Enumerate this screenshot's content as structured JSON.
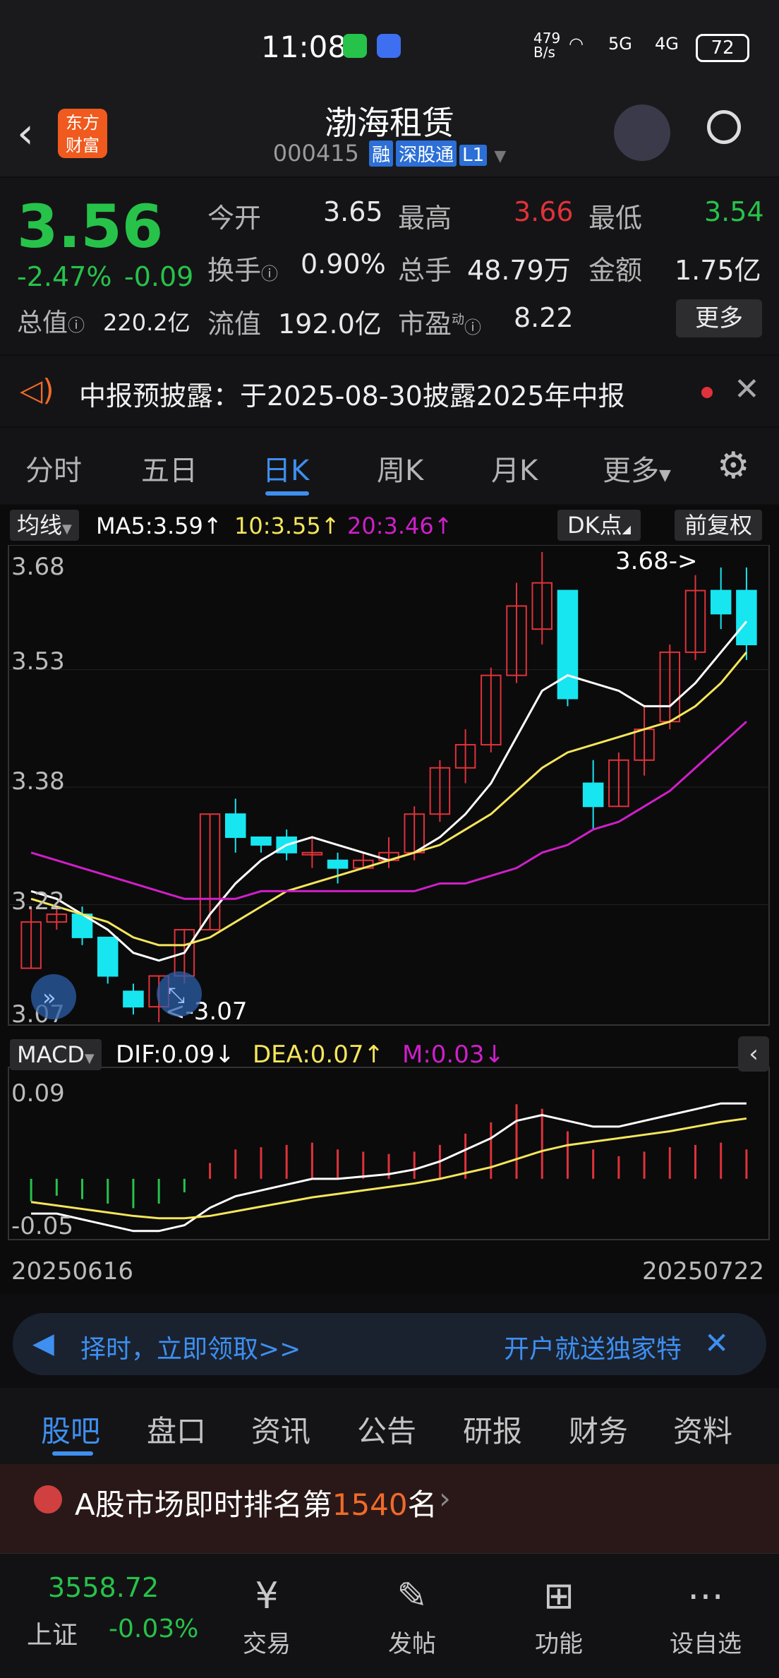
{
  "status": {
    "time": "11:08",
    "net_speed": "479\nB/s",
    "net": "5G",
    "net2": "4G",
    "battery": "72"
  },
  "header": {
    "title": "渤海租赁",
    "code": "000415",
    "tags": [
      "融",
      "深股通",
      "L1"
    ],
    "logo_line1": "东方",
    "logo_line2": "财富"
  },
  "quote": {
    "price": "3.56",
    "change_pct": "-2.47%",
    "change": "-0.09",
    "open_label": "今开",
    "open": "3.65",
    "high_label": "最高",
    "high": "3.66",
    "low_label": "最低",
    "low": "3.54",
    "turnover_label": "换手",
    "turnover": "0.90%",
    "volume_label": "总手",
    "volume": "48.79万",
    "amount_label": "金额",
    "amount": "1.75亿",
    "mcap_label": "总值",
    "mcap": "220.2亿",
    "float_label": "流值",
    "float": "192.0亿",
    "pe_label": "市盈",
    "pe_sup": "动",
    "pe": "8.22",
    "more": "更多"
  },
  "notice": {
    "text": "中报预披露：于2025-08-30披露2025年中报"
  },
  "tabs": [
    "分时",
    "五日",
    "日K",
    "周K",
    "月K",
    "更多"
  ],
  "chart": {
    "ma_label": "均线",
    "ma5": "MA5:3.59↑",
    "ma10": "10:3.55↑",
    "ma20": "20:3.46↑",
    "dk": "DK点",
    "adjust": "前复权",
    "y_ticks": [
      "3.68",
      "3.53",
      "3.38",
      "3.22",
      "3.07"
    ],
    "high_mark": "3.68->",
    "low_mark": "<-3.07",
    "macd_label": "MACD",
    "dif": "DIF:0.09↓",
    "dea": "DEA:0.07↑",
    "m": "M:0.03↓",
    "macd_ticks": [
      "0.09",
      "-0.05"
    ],
    "date_start": "20250616",
    "date_end": "20250722",
    "colors": {
      "up": "#e0323a",
      "down": "#17e6f0",
      "ma5": "#ffffff",
      "ma10": "#f5e65a",
      "ma20": "#d01fc9"
    }
  },
  "chart_data": {
    "type": "candlestick",
    "x": [
      "20250616",
      "20250722"
    ],
    "ylim": [
      3.07,
      3.68
    ],
    "candles": [
      {
        "o": 3.14,
        "c": 3.2,
        "h": 3.22,
        "l": 3.14
      },
      {
        "o": 3.2,
        "c": 3.21,
        "h": 3.22,
        "l": 3.19
      },
      {
        "o": 3.21,
        "c": 3.18,
        "h": 3.22,
        "l": 3.17
      },
      {
        "o": 3.18,
        "c": 3.13,
        "h": 3.18,
        "l": 3.12
      },
      {
        "o": 3.11,
        "c": 3.09,
        "h": 3.12,
        "l": 3.08
      },
      {
        "o": 3.09,
        "c": 3.13,
        "h": 3.13,
        "l": 3.07
      },
      {
        "o": 3.13,
        "c": 3.19,
        "h": 3.19,
        "l": 3.12
      },
      {
        "o": 3.19,
        "c": 3.34,
        "h": 3.34,
        "l": 3.19
      },
      {
        "o": 3.34,
        "c": 3.31,
        "h": 3.36,
        "l": 3.29
      },
      {
        "o": 3.31,
        "c": 3.3,
        "h": 3.31,
        "l": 3.29
      },
      {
        "o": 3.31,
        "c": 3.29,
        "h": 3.32,
        "l": 3.28
      },
      {
        "o": 3.29,
        "c": 3.29,
        "h": 3.31,
        "l": 3.27
      },
      {
        "o": 3.28,
        "c": 3.27,
        "h": 3.29,
        "l": 3.25
      },
      {
        "o": 3.27,
        "c": 3.28,
        "h": 3.29,
        "l": 3.27
      },
      {
        "o": 3.28,
        "c": 3.29,
        "h": 3.31,
        "l": 3.27
      },
      {
        "o": 3.29,
        "c": 3.34,
        "h": 3.35,
        "l": 3.28
      },
      {
        "o": 3.34,
        "c": 3.4,
        "h": 3.41,
        "l": 3.33
      },
      {
        "o": 3.4,
        "c": 3.43,
        "h": 3.45,
        "l": 3.38
      },
      {
        "o": 3.43,
        "c": 3.52,
        "h": 3.53,
        "l": 3.42
      },
      {
        "o": 3.52,
        "c": 3.61,
        "h": 3.64,
        "l": 3.51
      },
      {
        "o": 3.58,
        "c": 3.64,
        "h": 3.68,
        "l": 3.56
      },
      {
        "o": 3.63,
        "c": 3.49,
        "h": 3.63,
        "l": 3.48
      },
      {
        "o": 3.38,
        "c": 3.35,
        "h": 3.41,
        "l": 3.32
      },
      {
        "o": 3.35,
        "c": 3.41,
        "h": 3.42,
        "l": 3.35
      },
      {
        "o": 3.41,
        "c": 3.45,
        "h": 3.48,
        "l": 3.39
      },
      {
        "o": 3.46,
        "c": 3.55,
        "h": 3.56,
        "l": 3.45
      },
      {
        "o": 3.55,
        "c": 3.63,
        "h": 3.65,
        "l": 3.54
      },
      {
        "o": 3.63,
        "c": 3.6,
        "h": 3.66,
        "l": 3.58
      },
      {
        "o": 3.63,
        "c": 3.56,
        "h": 3.66,
        "l": 3.54
      }
    ],
    "ma5": [
      3.24,
      3.23,
      3.21,
      3.19,
      3.16,
      3.15,
      3.16,
      3.21,
      3.25,
      3.28,
      3.3,
      3.31,
      3.3,
      3.29,
      3.28,
      3.29,
      3.31,
      3.34,
      3.38,
      3.44,
      3.5,
      3.52,
      3.51,
      3.5,
      3.48,
      3.48,
      3.51,
      3.55,
      3.59
    ],
    "ma10": [
      3.23,
      3.22,
      3.21,
      3.2,
      3.18,
      3.17,
      3.17,
      3.18,
      3.2,
      3.22,
      3.24,
      3.25,
      3.26,
      3.27,
      3.28,
      3.29,
      3.3,
      3.32,
      3.34,
      3.37,
      3.4,
      3.42,
      3.43,
      3.44,
      3.45,
      3.46,
      3.48,
      3.51,
      3.55
    ],
    "ma20": [
      3.29,
      3.28,
      3.27,
      3.26,
      3.25,
      3.24,
      3.23,
      3.23,
      3.23,
      3.24,
      3.24,
      3.24,
      3.24,
      3.24,
      3.24,
      3.24,
      3.25,
      3.25,
      3.26,
      3.27,
      3.29,
      3.3,
      3.32,
      3.33,
      3.35,
      3.37,
      3.4,
      3.43,
      3.46
    ],
    "macd_ylim": [
      -0.05,
      0.09
    ],
    "dif": [
      -0.03,
      -0.03,
      -0.035,
      -0.04,
      -0.045,
      -0.045,
      -0.04,
      -0.025,
      -0.015,
      -0.01,
      -0.005,
      0.0,
      0.0,
      0.002,
      0.004,
      0.008,
      0.015,
      0.025,
      0.035,
      0.05,
      0.055,
      0.05,
      0.045,
      0.045,
      0.05,
      0.055,
      0.06,
      0.065,
      0.065
    ],
    "dea": [
      -0.02,
      -0.023,
      -0.026,
      -0.029,
      -0.032,
      -0.034,
      -0.034,
      -0.032,
      -0.028,
      -0.024,
      -0.02,
      -0.016,
      -0.013,
      -0.01,
      -0.007,
      -0.004,
      0.0,
      0.005,
      0.01,
      0.017,
      0.024,
      0.029,
      0.032,
      0.035,
      0.038,
      0.041,
      0.045,
      0.049,
      0.052
    ],
    "macd_hist": [
      -0.02,
      -0.015,
      -0.018,
      -0.022,
      -0.026,
      -0.022,
      -0.012,
      0.014,
      0.026,
      0.028,
      0.03,
      0.032,
      0.026,
      0.024,
      0.022,
      0.024,
      0.03,
      0.04,
      0.05,
      0.066,
      0.062,
      0.042,
      0.026,
      0.02,
      0.024,
      0.028,
      0.03,
      0.032,
      0.026
    ]
  },
  "promo": {
    "left": "择时，立即领取>>",
    "right": "开户就送独家特"
  },
  "bottom_tabs": [
    "股吧",
    "盘口",
    "资讯",
    "公告",
    "研报",
    "财务",
    "资料"
  ],
  "rank": {
    "prefix": "A股市场即时排名第",
    "num": "1540",
    "suffix": "名"
  },
  "index": {
    "value": "3558.72",
    "name": "上证",
    "change": "-0.03%"
  },
  "nav": [
    {
      "icon": "exchange-icon",
      "label": "交易"
    },
    {
      "icon": "edit-icon",
      "label": "发帖"
    },
    {
      "icon": "apps-icon",
      "label": "功能"
    },
    {
      "icon": "more-icon",
      "label": "设自选"
    }
  ]
}
